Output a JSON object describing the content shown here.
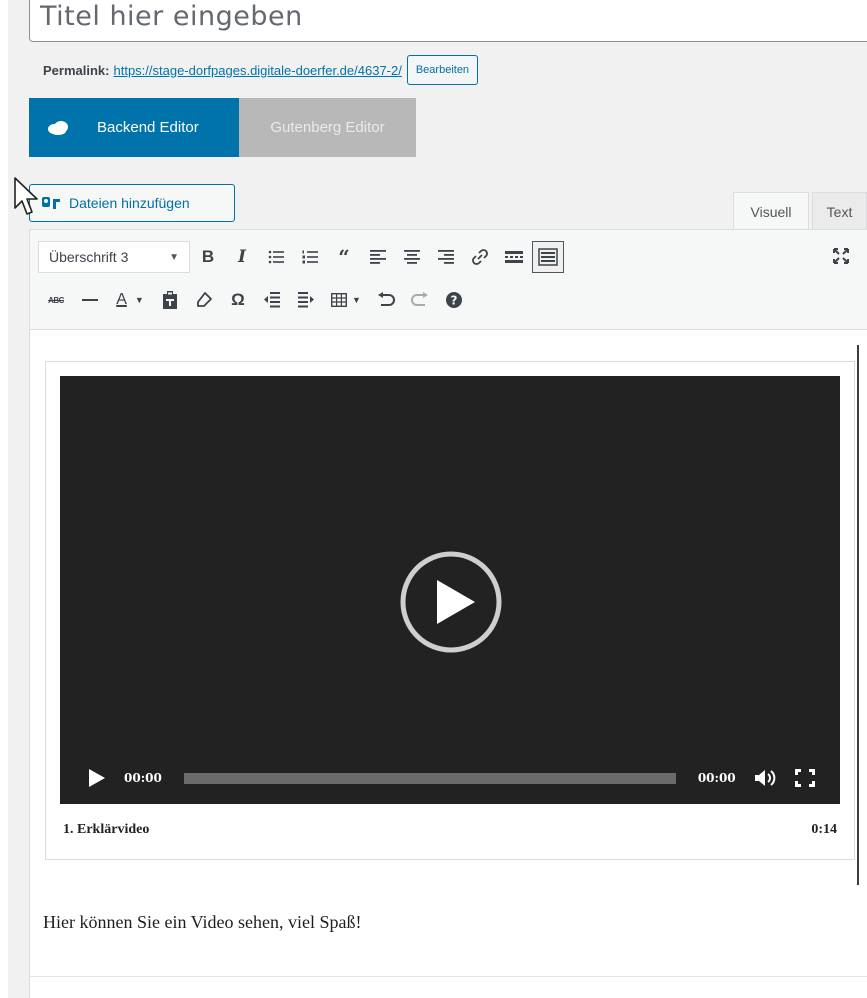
{
  "title": {
    "placeholder": "Titel hier eingeben"
  },
  "permalink": {
    "label": "Permalink:",
    "url": "https://stage-dorfpages.digitale-doerfer.de/4637-2/",
    "edit_label": "Bearbeiten"
  },
  "editor_switch": {
    "backend_label": "Backend Editor",
    "gutenberg_label": "Gutenberg Editor"
  },
  "media": {
    "add_label": "Dateien hinzufügen",
    "icon": "add-media-icon"
  },
  "tabs": {
    "visual": "Visuell",
    "text": "Text"
  },
  "toolbar": {
    "format_select": "Überschrift 3",
    "row1": [
      "bold",
      "italic",
      "bullet-list",
      "numbered-list",
      "blockquote",
      "align-left",
      "align-center",
      "align-right",
      "link",
      "read-more",
      "toolbar-toggle"
    ],
    "row2": [
      "strikethrough",
      "horizontal-line",
      "text-color",
      "paste-as-text",
      "clear-formatting",
      "special-character",
      "outdent",
      "indent",
      "table",
      "undo",
      "redo",
      "help"
    ],
    "labels": {
      "bold": "B",
      "italic": "I",
      "strike": "ABC",
      "textcolor": "A",
      "omega": "Ω",
      "help": "?"
    }
  },
  "video": {
    "current_time": "00:00",
    "duration_time": "00:00",
    "progress": 0,
    "caption_title": "1. Erklärvideo",
    "caption_length": "0:14"
  },
  "content": {
    "paragraph": "Hier können Sie ein Video sehen, viel Spaß!"
  },
  "colors": {
    "accent": "#0073aa",
    "player_bg": "#222222",
    "gutenberg_bg": "#b8b8b8"
  }
}
